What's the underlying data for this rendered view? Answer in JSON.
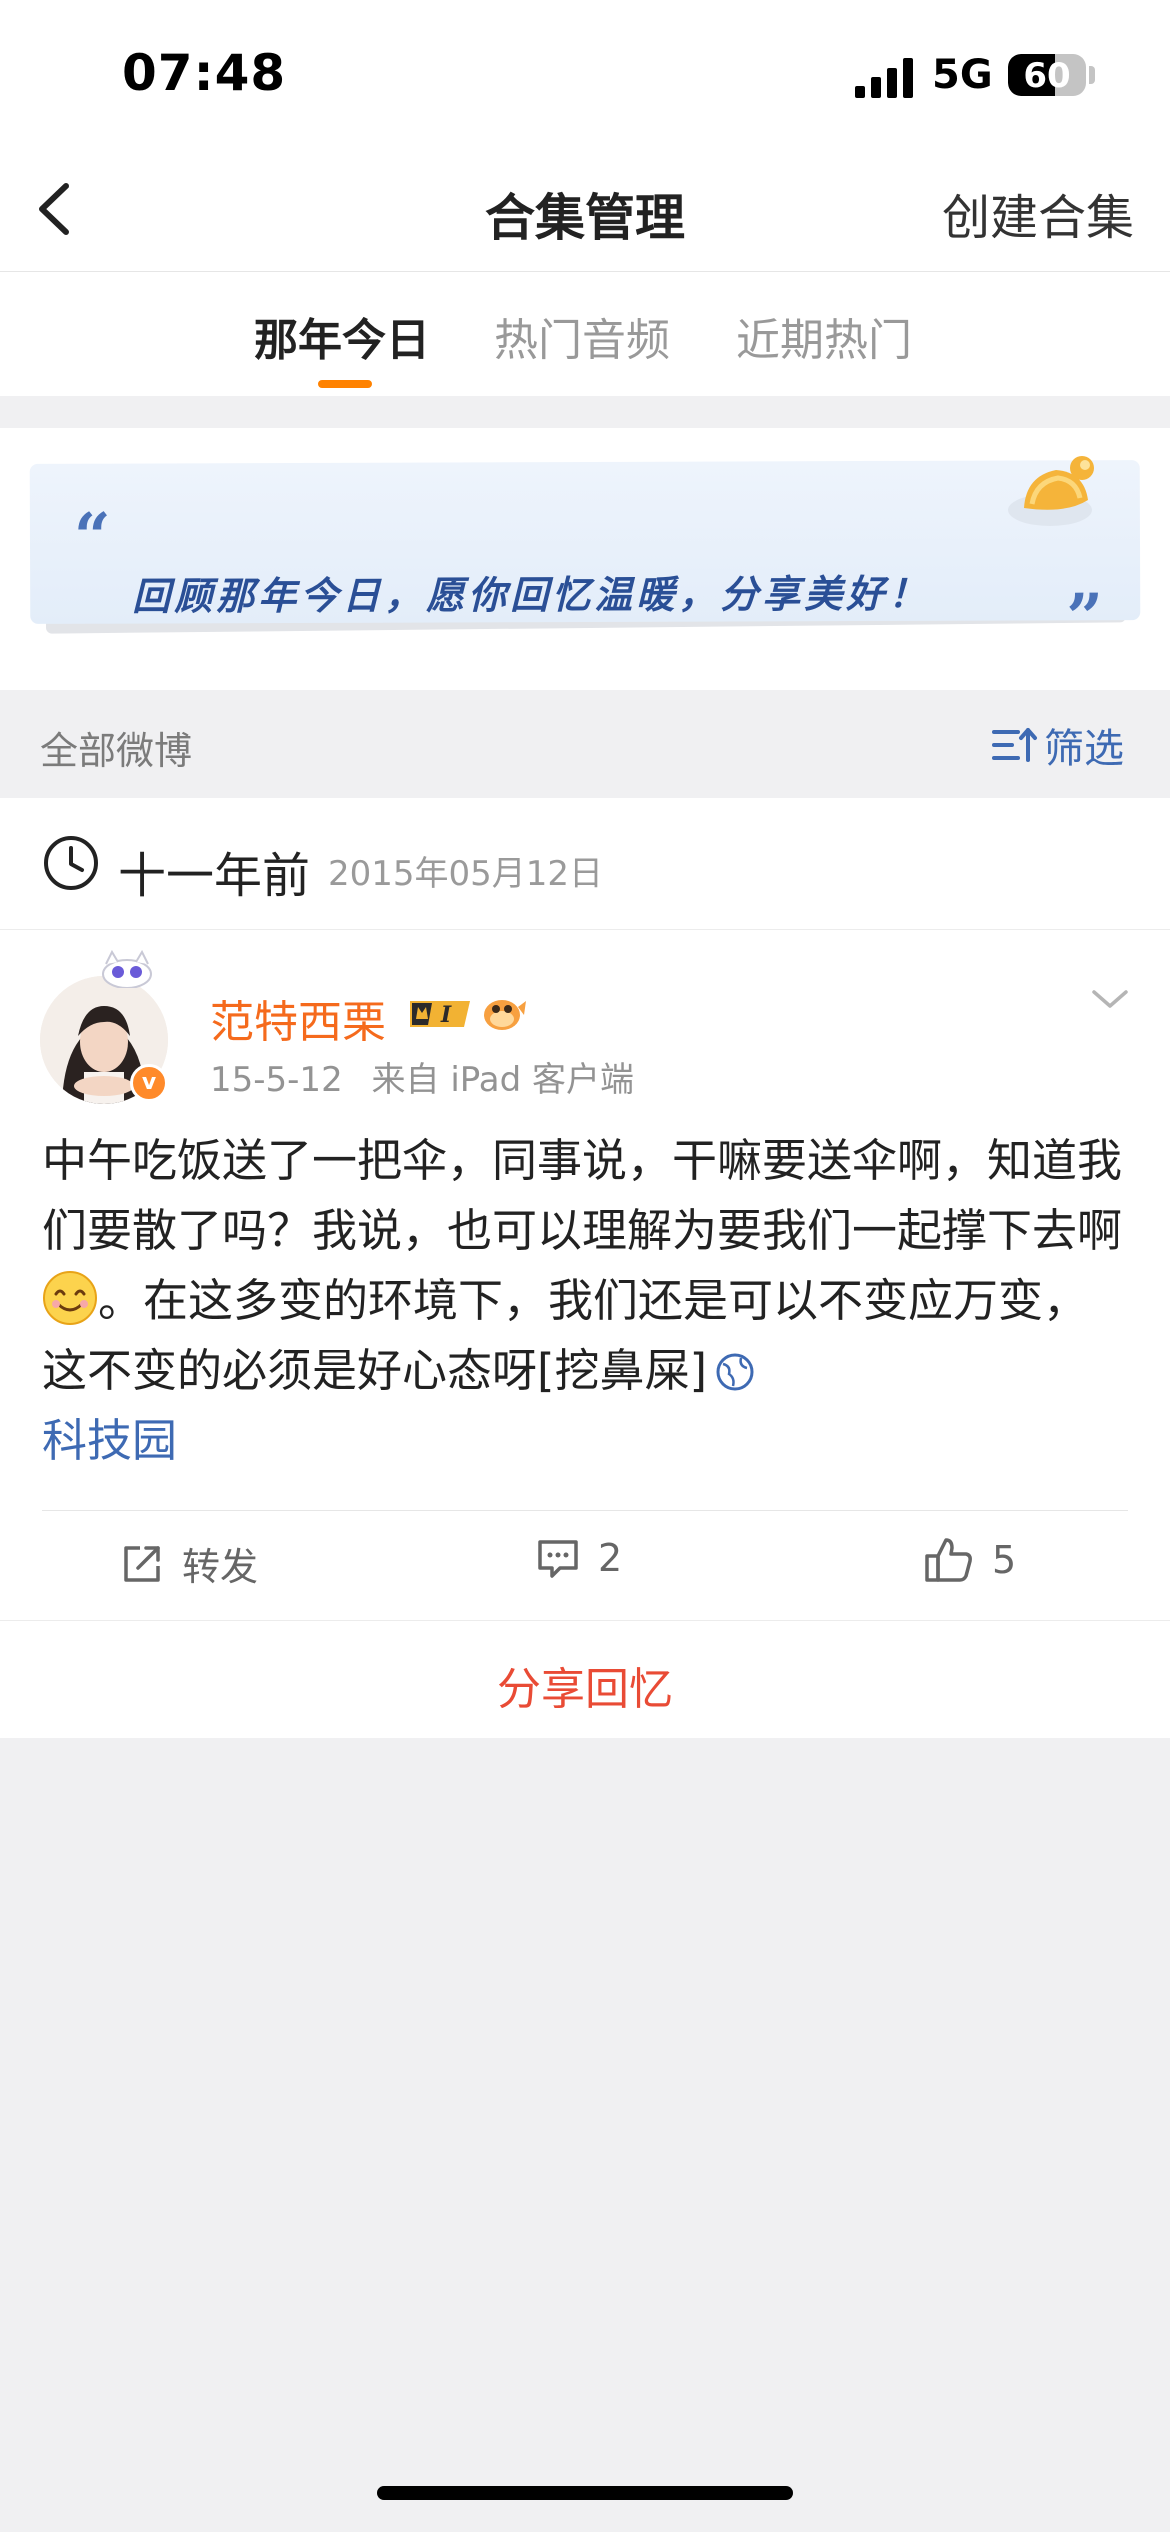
{
  "status_bar": {
    "time": "07:48",
    "network": "5G",
    "battery": "60",
    "battery_level": 0.6
  },
  "nav": {
    "title": "合集管理",
    "action": "创建合集"
  },
  "tabs": [
    {
      "label": "那年今日",
      "active": true
    },
    {
      "label": "热门音频",
      "active": false
    },
    {
      "label": "近期热门",
      "active": false
    }
  ],
  "banner": {
    "open_quote": "“",
    "text": "回顾那年今日，愿你回忆温暖，分享美好！",
    "close_quote": "”"
  },
  "filter": {
    "label": "全部微博",
    "button": "筛选"
  },
  "section": {
    "years_ago": "十一年前",
    "date": "2015年05月12日"
  },
  "post": {
    "username": "范特西栗",
    "verify_mark": "v",
    "level_badge": "I",
    "date": "15-5-12",
    "source": "来自 iPad 客户端",
    "text_a": "中午吃饭送了一把伞，同事说，干嘛要送伞啊，知道我们要散了吗？我说，也可以理解为要我们一起撑下去啊",
    "emoji_name": "smile-emoji",
    "text_b": "。在这多变的环境下，我们还是可以不变应万变，这不变的必须是好心态呀[挖鼻屎]",
    "location": "科技园",
    "repost_label": "转发",
    "comment_count": "2",
    "like_count": "5"
  },
  "share": {
    "label": "分享回忆"
  },
  "colors": {
    "accent_orange": "#ff8200",
    "username_orange": "#f56a1c",
    "link_blue": "#3e6ab3",
    "share_red": "#e94b35"
  }
}
